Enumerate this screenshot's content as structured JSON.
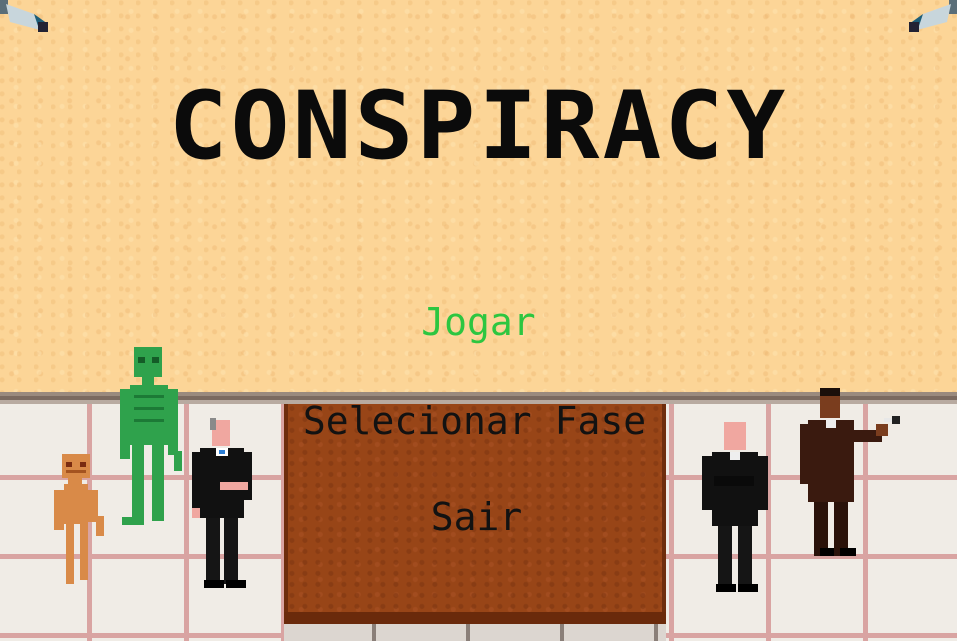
{
  "game": {
    "title": "CONSPIRACY",
    "menu": {
      "play": "Jogar",
      "select_level": "Selecionar Fase",
      "exit": "Sair",
      "highlighted": "Jogar"
    }
  },
  "colors": {
    "wall": "#fcd597",
    "floor": "#f0ece6",
    "table": "#984517",
    "highlight": "#2dc640",
    "text": "#121212"
  },
  "icons": [
    "security-camera-icon",
    "security-camera-icon"
  ],
  "characters": [
    "orange-alien",
    "green-alien",
    "agent-in-suit",
    "bald-agent",
    "brown-suit-man"
  ]
}
